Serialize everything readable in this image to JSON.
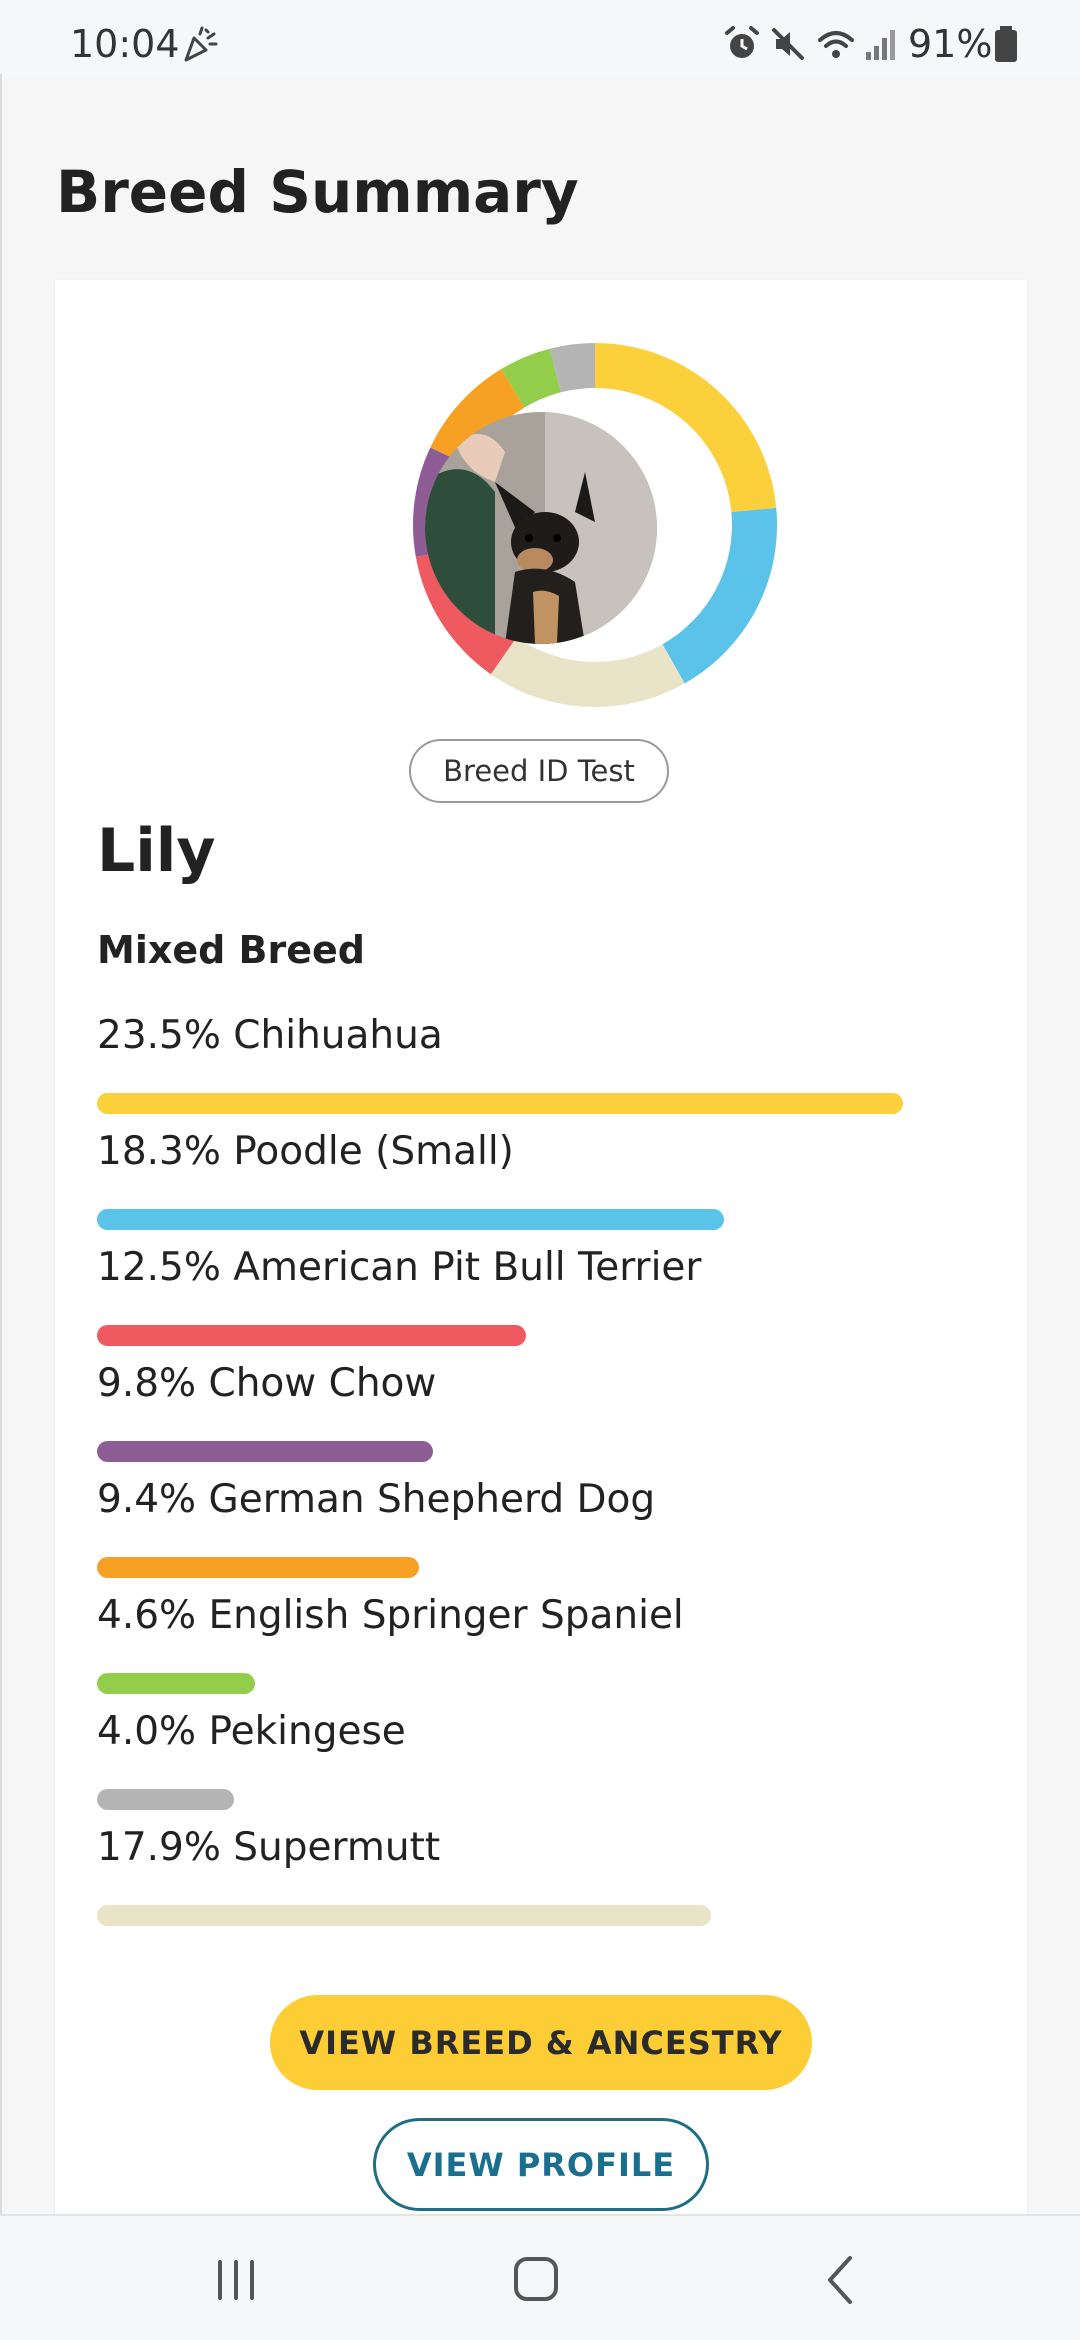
{
  "status_bar": {
    "time": "10:04",
    "battery_percent": "91%",
    "icons": [
      "party-popper-icon",
      "alarm-icon",
      "mute-icon",
      "wifi-icon",
      "signal-icon",
      "battery-icon"
    ]
  },
  "page": {
    "title": "Breed Summary"
  },
  "card": {
    "test_label": "Breed ID Test",
    "dog_name": "Lily",
    "mix_label": "Mixed Breed",
    "breeds": [
      {
        "label": "23.5% Chihuahua",
        "percent": 23.5,
        "bar_fraction": 1.0,
        "color": "#fbd03a"
      },
      {
        "label": "18.3% Poodle (Small)",
        "percent": 18.3,
        "bar_fraction": 0.778,
        "color": "#5bc2ea"
      },
      {
        "label": "12.5% American Pit Bull Terrier",
        "percent": 12.5,
        "bar_fraction": 0.532,
        "color": "#ee5a5f"
      },
      {
        "label": "9.8% Chow Chow",
        "percent": 9.8,
        "bar_fraction": 0.417,
        "color": "#8e5d95"
      },
      {
        "label": "9.4% German Shepherd Dog",
        "percent": 9.4,
        "bar_fraction": 0.4,
        "color": "#f6a024"
      },
      {
        "label": "4.6% English Springer Spaniel",
        "percent": 4.6,
        "bar_fraction": 0.196,
        "color": "#93cd4c"
      },
      {
        "label": "4.0% Pekingese",
        "percent": 4.0,
        "bar_fraction": 0.17,
        "color": "#b4b4b4"
      },
      {
        "label": "17.9% Supermutt",
        "percent": 17.9,
        "bar_fraction": 0.762,
        "color": "#e9e3c8"
      }
    ],
    "primary_button": "VIEW BREED & ANCESTRY",
    "secondary_button": "VIEW PROFILE"
  },
  "nav_bar": {
    "buttons": [
      "recent-apps-icon",
      "home-icon",
      "back-icon"
    ]
  },
  "colors": {
    "accent_yellow": "#fccd34",
    "accent_teal": "#1a6e8e"
  }
}
